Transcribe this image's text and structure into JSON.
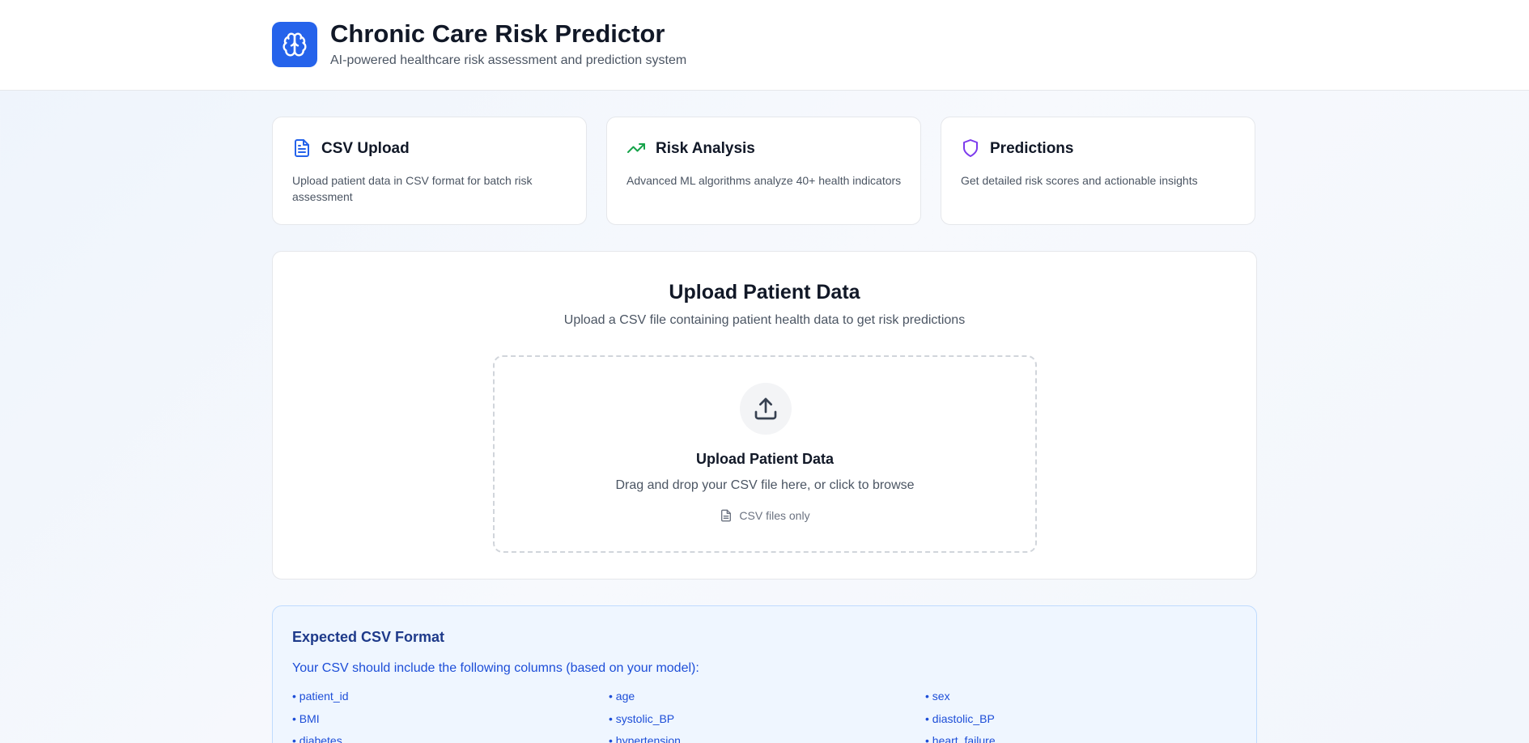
{
  "header": {
    "title": "Chronic Care Risk Predictor",
    "subtitle": "AI-powered healthcare risk assessment and prediction system",
    "logo_icon": "brain-icon",
    "accent_color": "#2563eb"
  },
  "features": [
    {
      "title": "CSV Upload",
      "description": "Upload patient data in CSV format for batch risk assessment",
      "icon": "file-text-icon",
      "color": "#2563eb"
    },
    {
      "title": "Risk Analysis",
      "description": "Advanced ML algorithms analyze 40+ health indicators",
      "icon": "trending-up-icon",
      "color": "#16a34a"
    },
    {
      "title": "Predictions",
      "description": "Get detailed risk scores and actionable insights",
      "icon": "shield-icon",
      "color": "#7c3aed"
    }
  ],
  "upload": {
    "title": "Upload Patient Data",
    "subtitle": "Upload a CSV file containing patient health data to get risk predictions",
    "dropzone": {
      "title": "Upload Patient Data",
      "hint": "Drag and drop your CSV file here, or click to browse",
      "note": "CSV files only",
      "icon": "upload-icon"
    }
  },
  "format": {
    "title": "Expected CSV Format",
    "intro": "Your CSV should include the following columns (based on your model):",
    "columns": [
      "• patient_id",
      "• age",
      "• sex",
      "• BMI",
      "• systolic_BP",
      "• diastolic_BP",
      "• diabetes",
      "• hypertension",
      "• heart_failure"
    ]
  }
}
